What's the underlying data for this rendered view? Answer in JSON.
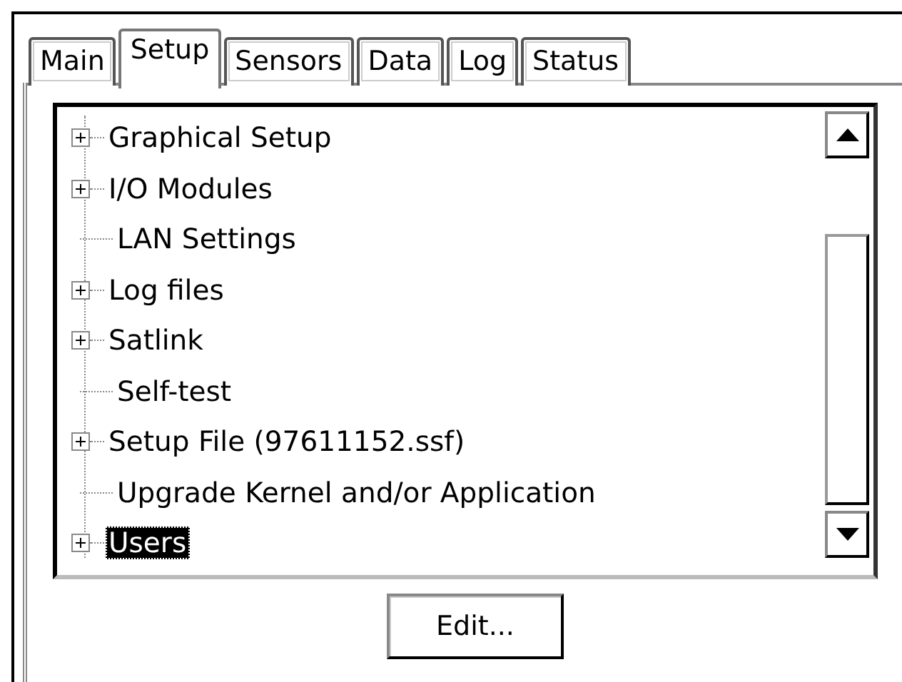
{
  "tabs": [
    {
      "label": "Main",
      "selected": false
    },
    {
      "label": "Setup",
      "selected": true
    },
    {
      "label": "Sensors",
      "selected": false
    },
    {
      "label": "Data",
      "selected": false
    },
    {
      "label": "Log",
      "selected": false
    },
    {
      "label": "Status",
      "selected": false
    }
  ],
  "tree": {
    "items": [
      {
        "label": "Graphical Setup",
        "kind": "group",
        "selected": false
      },
      {
        "label": "I/O Modules",
        "kind": "group",
        "selected": false
      },
      {
        "label": "LAN Settings",
        "kind": "leaf",
        "selected": false
      },
      {
        "label": "Log files",
        "kind": "group",
        "selected": false
      },
      {
        "label": "Satlink",
        "kind": "group",
        "selected": false
      },
      {
        "label": "Self-test",
        "kind": "leaf",
        "selected": false
      },
      {
        "label": "Setup File (97611152.ssf)",
        "kind": "group",
        "selected": false
      },
      {
        "label": "Upgrade Kernel and/or Application",
        "kind": "leaf",
        "selected": false
      },
      {
        "label": "Users",
        "kind": "group",
        "selected": true
      }
    ]
  },
  "buttons": [
    "Edit..."
  ]
}
